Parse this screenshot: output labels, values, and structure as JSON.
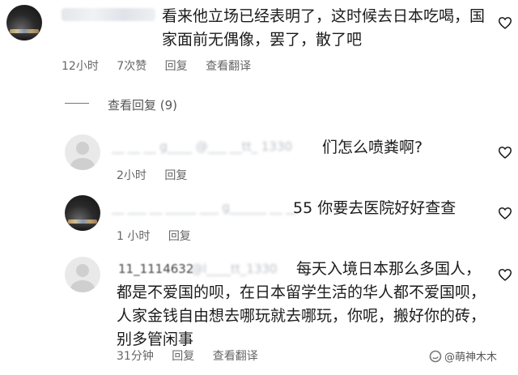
{
  "comment_main": {
    "text": "看来他立场已经表明了，这时候去日本吃喝，国家面前无偶像，罢了，散了吧",
    "time": "12小时",
    "likes": "7次赞",
    "reply_label": "回复",
    "translate_label": "查看翻译"
  },
  "view_replies": {
    "label": "查看回复 (9)"
  },
  "replies": [
    {
      "text": "们怎么喷粪啊?",
      "time": "2小时",
      "reply_label": "回复"
    },
    {
      "text": "55 你要去医院好好查查",
      "time": "1 小时",
      "reply_label": "回复"
    },
    {
      "handle": "11_1114632",
      "text": "每天入境日本那么多国人，都是不爱国的呗，在日本留学生活的华人都不爱国呗，人家金钱自由想去哪玩就去哪玩，你呢，搬好你的砖，别多管闲事",
      "time": "31分钟",
      "reply_label": "回复",
      "translate_label": "查看翻译"
    }
  ],
  "watermark": {
    "text": "@萌神木木"
  },
  "icons": {
    "like": "heart-outline-icon",
    "watermark_logo": "sogou-logo-icon"
  }
}
